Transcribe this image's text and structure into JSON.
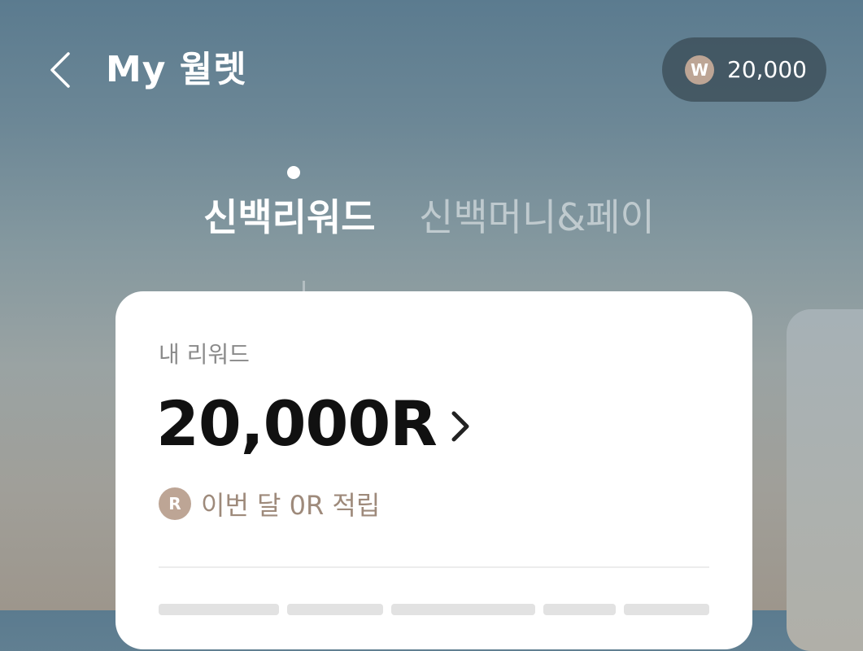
{
  "header": {
    "title": "My 월렛",
    "balance": {
      "badge_letter": "W",
      "amount": "20,000"
    }
  },
  "tabs": [
    {
      "label": "신백리워드",
      "active": true
    },
    {
      "label": "신백머니&페이",
      "active": false
    }
  ],
  "reward_card": {
    "label": "내 리워드",
    "amount": "20,000R",
    "monthly_badge": "R",
    "monthly_text": "이번 달 0R 적립"
  },
  "colors": {
    "accent": "#bda595",
    "accent_text": "#9e8a7b",
    "pill_bg": "#374852"
  },
  "icons": {
    "back": "chevron-left-icon",
    "reward_detail": "chevron-right-icon"
  }
}
